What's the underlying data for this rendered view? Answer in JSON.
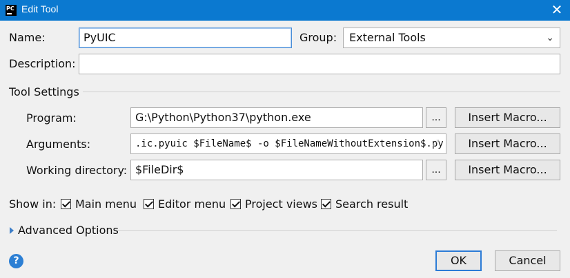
{
  "window": {
    "title": "Edit Tool",
    "app_icon_text": "PC"
  },
  "form": {
    "name_label": "Name:",
    "name_value": "PyUIC",
    "group_label": "Group:",
    "group_value": "External Tools",
    "description_label": "Description:",
    "description_value": ""
  },
  "tool_settings": {
    "section_label": "Tool Settings",
    "program_label": "Program:",
    "program_value": "G:\\Python\\Python37\\python.exe",
    "arguments_label": "Arguments:",
    "arguments_value": ".ic.pyuic  $FileName$ -o $FileNameWithoutExtension$.py",
    "workdir_label": "Working directory:",
    "workdir_value": "$FileDir$",
    "browse_label": "...",
    "insert_macro_label": "Insert Macro..."
  },
  "show_in": {
    "label": "Show in:",
    "options": [
      {
        "label": "Main menu",
        "checked": true
      },
      {
        "label": "Editor menu",
        "checked": true
      },
      {
        "label": "Project views",
        "checked": true
      },
      {
        "label": "Search result",
        "checked": true
      }
    ]
  },
  "advanced": {
    "label": "Advanced Options",
    "expanded": false
  },
  "footer": {
    "help_icon_text": "?",
    "ok_label": "OK",
    "cancel_label": "Cancel"
  },
  "colors": {
    "titlebar": "#0b79d0",
    "accent": "#2b7bd6"
  },
  "icons": [
    "close-icon",
    "dropdown-chevron-icon",
    "help-icon",
    "expand-arrow-icon",
    "resize-icon"
  ]
}
